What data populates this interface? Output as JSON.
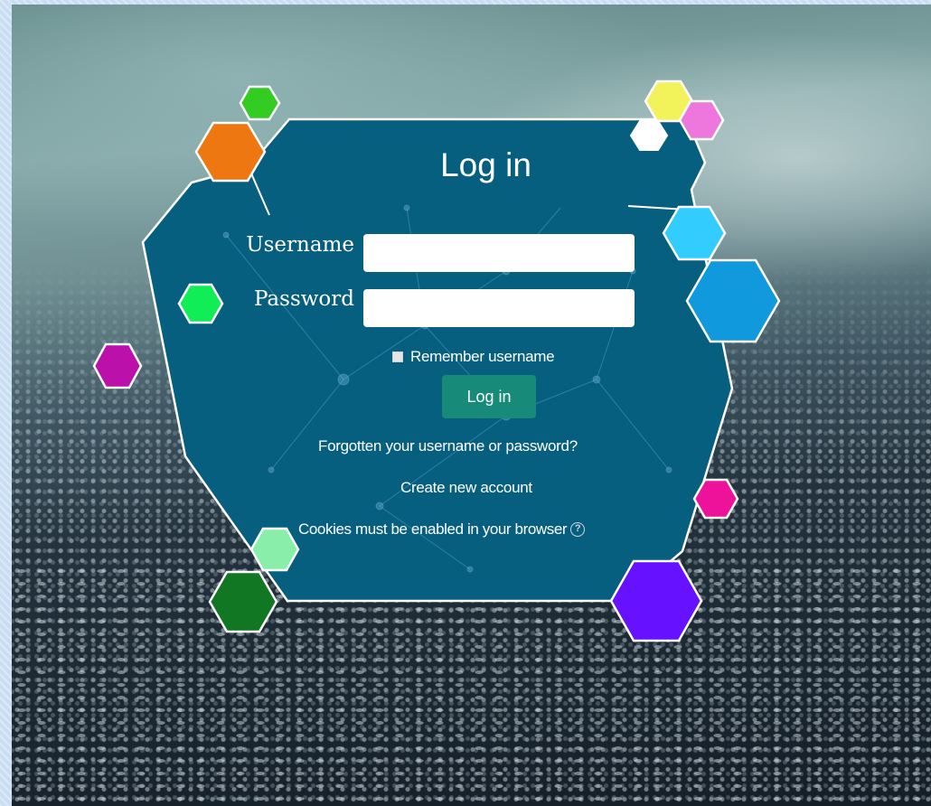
{
  "login": {
    "title": "Log in",
    "username_label": "Username",
    "username_value": "",
    "password_label": "Password",
    "password_value": "",
    "remember_label": "Remember username",
    "remember_checked": false,
    "submit_label": "Log in",
    "forgot_link": "Forgotten your username or password?",
    "create_account_link": "Create new account",
    "cookies_notice": "Cookies must be enabled in your browser",
    "help_icon": "question-circle-icon"
  },
  "colors": {
    "panel": "#075f80",
    "panel_border": "#ffffff",
    "button": "#178a7a",
    "frame": "#c9def2"
  },
  "decorative_hexagons": [
    {
      "name": "hex-green",
      "color": "#33cc22"
    },
    {
      "name": "hex-orange",
      "color": "#ee7711"
    },
    {
      "name": "hex-lime",
      "color": "#11ee55"
    },
    {
      "name": "hex-magenta",
      "color": "#bb11aa"
    },
    {
      "name": "hex-yellow",
      "color": "#f2f25a"
    },
    {
      "name": "hex-pink",
      "color": "#ee77dd"
    },
    {
      "name": "hex-white",
      "color": "#ffffff"
    },
    {
      "name": "hex-sky",
      "color": "#33ccff"
    },
    {
      "name": "hex-blue",
      "color": "#1199dd"
    },
    {
      "name": "hex-hotpink",
      "color": "#ee1199"
    },
    {
      "name": "hex-mint",
      "color": "#88eeaa"
    },
    {
      "name": "hex-darkgreen",
      "color": "#117722"
    },
    {
      "name": "hex-violet",
      "color": "#6611ff"
    }
  ]
}
